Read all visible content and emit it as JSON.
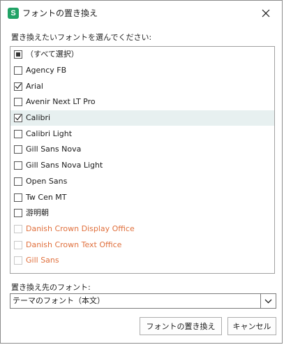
{
  "window": {
    "app_icon_letter": "S",
    "title": "フォントの置き換え",
    "close_glyph": "✕"
  },
  "font_list": {
    "label": "置き換えたいフォントを選んでください:",
    "items": [
      {
        "label": "（すべて選択）",
        "state": "indeterminate",
        "selected": false,
        "disabled": false
      },
      {
        "label": "Agency FB",
        "state": "unchecked",
        "selected": false,
        "disabled": false
      },
      {
        "label": "Arial",
        "state": "checked",
        "selected": false,
        "disabled": false
      },
      {
        "label": "Avenir Next LT Pro",
        "state": "unchecked",
        "selected": false,
        "disabled": false
      },
      {
        "label": "Calibri",
        "state": "checked",
        "selected": true,
        "disabled": false
      },
      {
        "label": "Calibri Light",
        "state": "unchecked",
        "selected": false,
        "disabled": false
      },
      {
        "label": "Gill Sans Nova",
        "state": "unchecked",
        "selected": false,
        "disabled": false
      },
      {
        "label": "Gill Sans Nova Light",
        "state": "unchecked",
        "selected": false,
        "disabled": false
      },
      {
        "label": "Open Sans",
        "state": "unchecked",
        "selected": false,
        "disabled": false
      },
      {
        "label": "Tw Cen MT",
        "state": "unchecked",
        "selected": false,
        "disabled": false
      },
      {
        "label": "游明朝",
        "state": "unchecked",
        "selected": false,
        "disabled": false
      },
      {
        "label": "Danish Crown Display Office",
        "state": "unchecked",
        "selected": false,
        "disabled": true
      },
      {
        "label": "Danish Crown Text Office",
        "state": "unchecked",
        "selected": false,
        "disabled": true
      },
      {
        "label": "Gill Sans",
        "state": "unchecked",
        "selected": false,
        "disabled": true
      }
    ]
  },
  "target_font": {
    "label": "置き換え先のフォント:",
    "value": "テーマのフォント（本文）"
  },
  "buttons": {
    "replace_label": "フォントの置き換え",
    "cancel_label": "キャンセル"
  },
  "colors": {
    "app_icon": "#21a366",
    "selected_row": "#e7f0f0",
    "disabled_text": "#e0703d"
  }
}
